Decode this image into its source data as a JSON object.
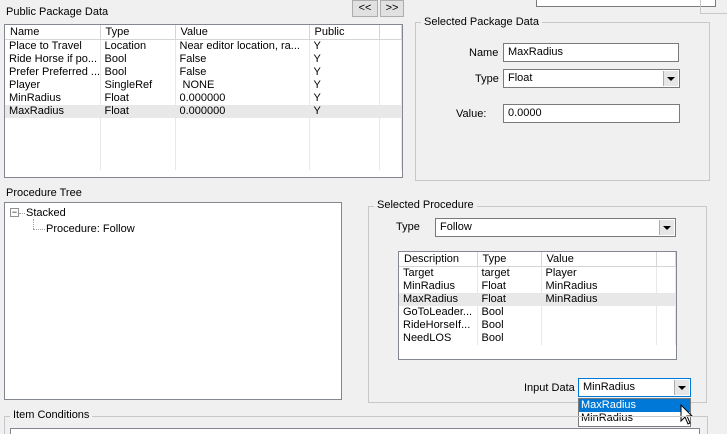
{
  "public_package": {
    "title": "Public Package Data",
    "nav_prev": "<<",
    "nav_next": ">>",
    "columns": [
      "Name",
      "Type",
      "Value",
      "Public"
    ],
    "rows": [
      [
        "Place to Travel",
        "Location",
        "Near editor location, ra...",
        "Y"
      ],
      [
        "Ride Horse if po...",
        "Bool",
        "False",
        "Y"
      ],
      [
        "Prefer Preferred ...",
        "Bool",
        "False",
        "Y"
      ],
      [
        "Player",
        "SingleRef",
        " NONE",
        "Y"
      ],
      [
        "MinRadius",
        "Float",
        "0.000000",
        "Y"
      ],
      [
        "MaxRadius",
        "Float",
        "0.000000",
        "Y"
      ]
    ],
    "selected_row": 5
  },
  "selected_package": {
    "title": "Selected Package Data",
    "name_label": "Name",
    "name_value": "MaxRadius",
    "type_label": "Type",
    "type_value": "Float",
    "value_label": "Value:",
    "value_value": "0.0000"
  },
  "procedure_tree": {
    "title": "Procedure Tree",
    "root": "Stacked",
    "root_toggle": "−",
    "child": "Procedure: Follow"
  },
  "selected_procedure": {
    "title": "Selected Procedure",
    "type_label": "Type",
    "type_value": "Follow",
    "columns": [
      "Description",
      "Type",
      "Value"
    ],
    "rows": [
      [
        "Target",
        "target",
        "Player"
      ],
      [
        "MinRadius",
        "Float",
        "MinRadius"
      ],
      [
        "MaxRadius",
        "Float",
        "MinRadius"
      ],
      [
        "GoToLeader...",
        "Bool",
        ""
      ],
      [
        "RideHorseIf...",
        "Bool",
        ""
      ],
      [
        "NeedLOS",
        "Bool",
        ""
      ]
    ],
    "selected_row": 2,
    "input_label": "Input Data",
    "input_value": "MinRadius",
    "input_options": [
      "MaxRadius",
      "MinRadius"
    ],
    "input_highlighted": 0
  },
  "item_conditions": {
    "title": "Item Conditions"
  }
}
